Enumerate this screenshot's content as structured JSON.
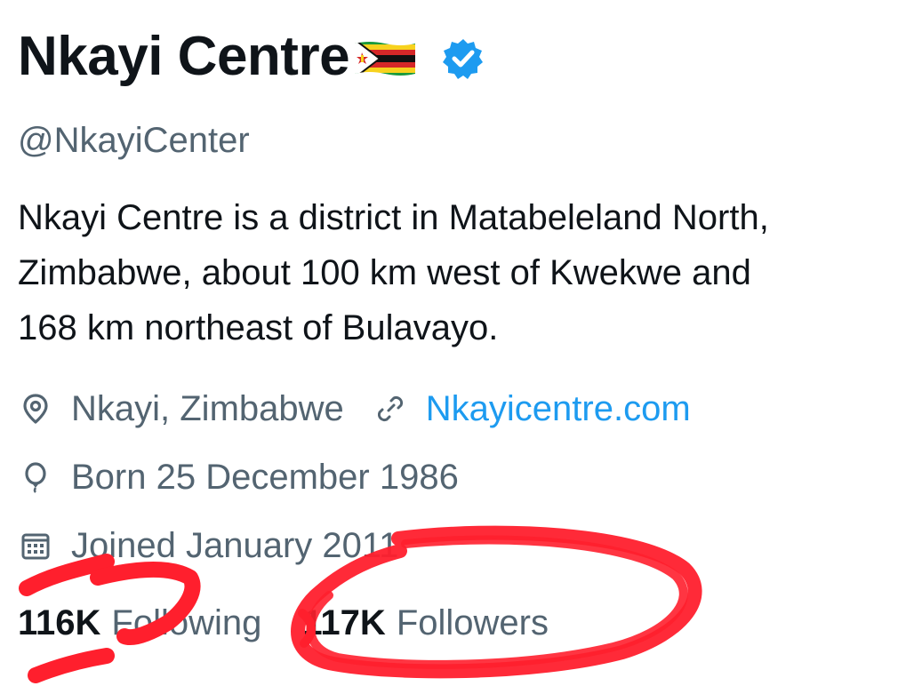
{
  "profile": {
    "display_name": "Nkayi Centre",
    "flag": "zimbabwe-flag",
    "verified": true,
    "handle": "@NkayiCenter",
    "bio_lines": [
      "Nkayi Centre is a district in Matabeleland North,",
      "Zimbabwe, about 100 km west of Kwekwe and",
      "168 km northeast of Bulavayo."
    ],
    "location": "Nkayi, Zimbabwe",
    "website": "Nkayicentre.com",
    "born": "Born 25 December 1986",
    "joined": "Joined January 2011",
    "following_count": "116K",
    "following_label": "Following",
    "followers_count": "117K",
    "followers_label": "Followers"
  },
  "icons": {
    "location": "location-pin-icon",
    "link": "link-icon",
    "birthday": "balloon-icon",
    "calendar": "calendar-icon",
    "verified": "verified-badge-icon"
  },
  "colors": {
    "text_primary": "#0f1419",
    "text_secondary": "#536471",
    "link": "#1d9bf0",
    "verified": "#1d9bf0",
    "annotation": "#ff1f2d"
  }
}
